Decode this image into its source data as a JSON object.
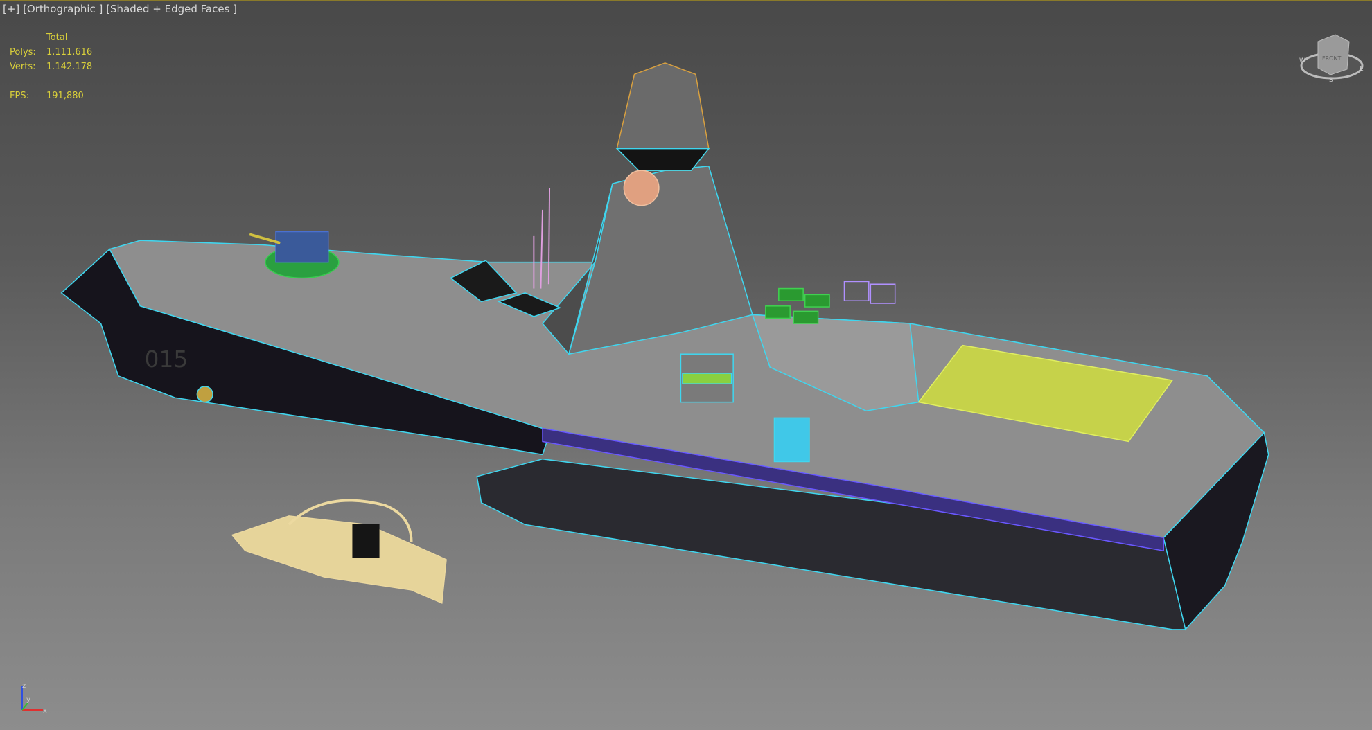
{
  "viewport": {
    "menu_label": "[+]",
    "view_label": "[Orthographic ]",
    "shading_label": "[Shaded + Edged Faces ]"
  },
  "stats": {
    "header": "Total",
    "polys_label": "Polys:",
    "polys_value": "1.111.616",
    "verts_label": "Verts:",
    "verts_value": "1.142.178",
    "fps_label": "FPS:",
    "fps_value": "191,880"
  },
  "viewcube": {
    "face_label": "FRONT",
    "compass": [
      "S",
      "E",
      "W"
    ]
  },
  "axis": {
    "x": "x",
    "y": "y",
    "z": "z"
  },
  "hull_number": "015",
  "colors": {
    "edge": "#3fd6ef",
    "hull_dark": "#111018",
    "deck": "#8c8c8c",
    "stats": "#d9cf3a",
    "boat": "#ecd9a0"
  }
}
